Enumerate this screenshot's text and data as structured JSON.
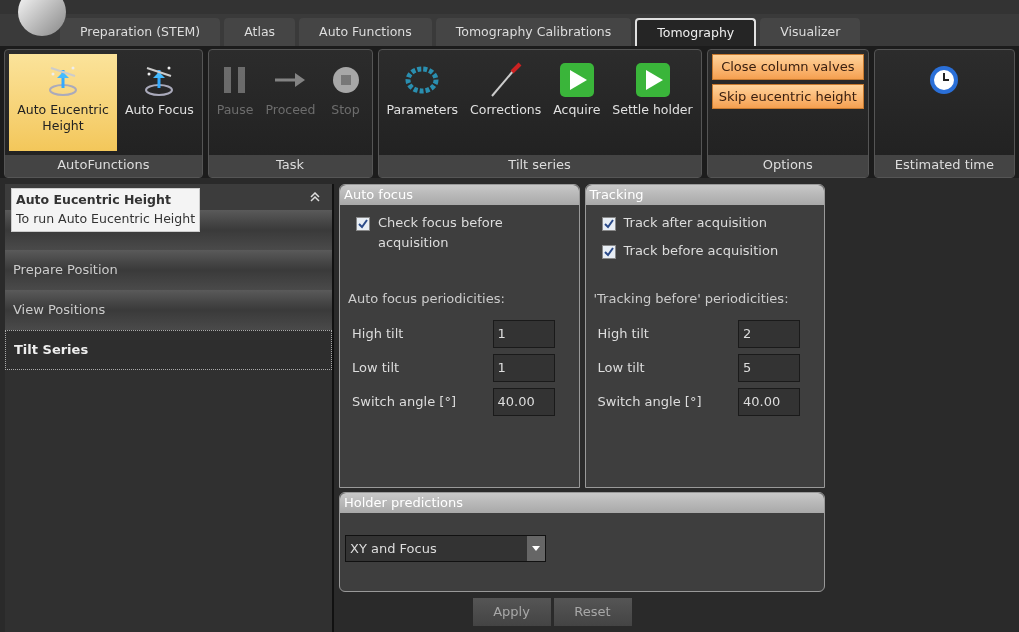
{
  "tabs": [
    {
      "label": "Preparation (STEM)",
      "selected": false
    },
    {
      "label": "Atlas",
      "selected": false
    },
    {
      "label": "Auto Functions",
      "selected": false
    },
    {
      "label": "Tomography Calibrations",
      "selected": false
    },
    {
      "label": "Tomography",
      "selected": true
    },
    {
      "label": "Visualizer",
      "selected": false
    }
  ],
  "ribbon": [
    {
      "title": "AutoFunctions",
      "items": [
        {
          "kind": "eucentric",
          "label": "Auto Eucentric Height",
          "selected": true
        },
        {
          "kind": "focus",
          "label": "Auto Focus",
          "selected": false
        }
      ]
    },
    {
      "title": "Task",
      "items": [
        {
          "kind": "pause",
          "label": "Pause",
          "disabled": true
        },
        {
          "kind": "proceed",
          "label": "Proceed",
          "disabled": true
        },
        {
          "kind": "stop",
          "label": "Stop",
          "disabled": true
        }
      ]
    },
    {
      "title": "Tilt series",
      "items": [
        {
          "kind": "parameters",
          "label": "Parameters"
        },
        {
          "kind": "corrections",
          "label": "Corrections"
        },
        {
          "kind": "play",
          "label": "Acquire"
        },
        {
          "kind": "play",
          "label": "Settle holder"
        }
      ]
    },
    {
      "title": "Options",
      "items": [
        {
          "kind": "option",
          "label": "Close column valves",
          "selected": true
        },
        {
          "kind": "option",
          "label": "Skip eucentric height",
          "selected": true
        }
      ]
    },
    {
      "title": "Estimated time",
      "items": [
        {
          "kind": "clock"
        }
      ]
    }
  ],
  "sidebar": {
    "tooltip": {
      "title": "Auto Eucentric Height",
      "text": "To run Auto Eucentric Height"
    },
    "items": [
      {
        "selected": false
      },
      {
        "label": "Prepare Position",
        "selected": false
      },
      {
        "label": "View Positions",
        "selected": false
      },
      {
        "label": "Tilt Series",
        "selected": true
      }
    ]
  },
  "auto_focus": {
    "title": "Auto focus",
    "checks": [
      {
        "label": "Check focus before acquisition",
        "checked": true
      }
    ],
    "periodicities_label": "Auto focus periodicities:",
    "fields": [
      {
        "label": "High tilt",
        "value": "1"
      },
      {
        "label": "Low tilt",
        "value": "1"
      },
      {
        "label": "Switch angle [°]",
        "value": "40.00"
      }
    ]
  },
  "tracking": {
    "title": "Tracking",
    "checks": [
      {
        "label": "Track after acquisition",
        "checked": true
      },
      {
        "label": "Track before acquisition",
        "checked": true
      }
    ],
    "periodicities_label": "'Tracking before' periodicities:",
    "fields": [
      {
        "label": "High tilt",
        "value": "2"
      },
      {
        "label": "Low tilt",
        "value": "5"
      },
      {
        "label": "Switch angle [°]",
        "value": "40.00"
      }
    ]
  },
  "holder_predictions": {
    "title": "Holder predictions",
    "value": "XY and Focus"
  },
  "buttons": [
    {
      "label": "Apply",
      "disabled": true
    },
    {
      "label": "Reset",
      "disabled": true
    }
  ]
}
